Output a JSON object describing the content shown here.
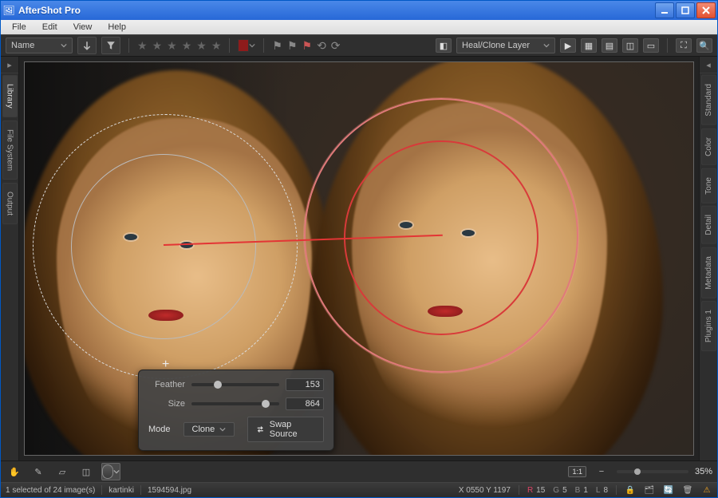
{
  "app_title": "AfterShot Pro",
  "menu": [
    "File",
    "Edit",
    "View",
    "Help"
  ],
  "toolbar": {
    "sort_select": "Name",
    "layer_select": "Heal/Clone Layer"
  },
  "side_tabs_left": [
    "Library",
    "File System",
    "Output"
  ],
  "side_tabs_right": [
    "Standard",
    "Color",
    "Tone",
    "Detail",
    "Metadata",
    "Plugins 1"
  ],
  "heal_panel": {
    "feather_label": "Feather",
    "feather_value": "153",
    "size_label": "Size",
    "size_value": "864",
    "mode_label": "Mode",
    "mode_value": "Clone",
    "swap_label": "Swap Source"
  },
  "zoom_pct": "35%",
  "status": {
    "selected_text": "1 selected of 24 image(s)",
    "folder": "kartinki",
    "filename": "1594594.jpg",
    "coord": "X 0550  Y 1197",
    "r": "15",
    "g": "5",
    "b": "1",
    "l": "8"
  }
}
